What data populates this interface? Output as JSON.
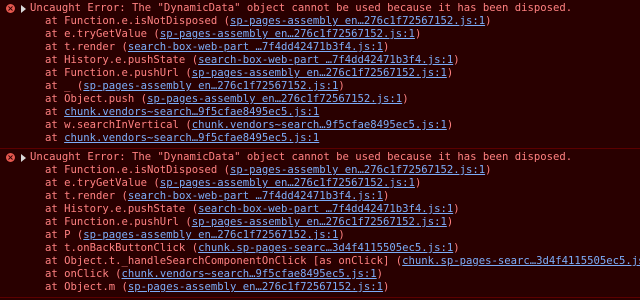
{
  "errors": [
    {
      "message": "Uncaught Error: The \"DynamicData\" object cannot be used because it has been disposed.",
      "frames": [
        {
          "fn": "at Function.e.isNotDisposed (",
          "src": "sp-pages-assembly en…276c1f72567152.js:1",
          "end": ")"
        },
        {
          "fn": "at e.tryGetValue (",
          "src": "sp-pages-assembly en…276c1f72567152.js:1",
          "end": ")"
        },
        {
          "fn": "at t.render (",
          "src": "search-box-web-part …7f4dd42471b3f4.js:1",
          "end": ")"
        },
        {
          "fn": "at History.e.pushState (",
          "src": "search-box-web-part …7f4dd42471b3f4.js:1",
          "end": ")"
        },
        {
          "fn": "at Function.e.pushUrl (",
          "src": "sp-pages-assembly en…276c1f72567152.js:1",
          "end": ")"
        },
        {
          "fn": "at _ (",
          "src": "sp-pages-assembly en…276c1f72567152.js:1",
          "end": ")"
        },
        {
          "fn": "at Object.push (",
          "src": "sp-pages-assembly en…276c1f72567152.js:1",
          "end": ")"
        },
        {
          "fn": "at ",
          "src": "chunk.vendors~search…9f5cfae8495ec5.js:1",
          "end": ""
        },
        {
          "fn": "at w.searchInVertical (",
          "src": "chunk.vendors~search…9f5cfae8495ec5.js:1",
          "end": ")"
        },
        {
          "fn": "at ",
          "src": "chunk.vendors~search…9f5cfae8495ec5.js:1",
          "end": ""
        }
      ]
    },
    {
      "message": "Uncaught Error: The \"DynamicData\" object cannot be used because it has been disposed.",
      "frames": [
        {
          "fn": "at Function.e.isNotDisposed (",
          "src": "sp-pages-assembly en…276c1f72567152.js:1",
          "end": ")"
        },
        {
          "fn": "at e.tryGetValue (",
          "src": "sp-pages-assembly en…276c1f72567152.js:1",
          "end": ")"
        },
        {
          "fn": "at t.render (",
          "src": "search-box-web-part …7f4dd42471b3f4.js:1",
          "end": ")"
        },
        {
          "fn": "at History.e.pushState (",
          "src": "search-box-web-part …7f4dd42471b3f4.js:1",
          "end": ")"
        },
        {
          "fn": "at Function.e.pushUrl (",
          "src": "sp-pages-assembly en…276c1f72567152.js:1",
          "end": ")"
        },
        {
          "fn": "at P (",
          "src": "sp-pages-assembly en…276c1f72567152.js:1",
          "end": ")"
        },
        {
          "fn": "at t.onBackButtonClick (",
          "src": "chunk.sp-pages-searc…3d4f4115505ec5.js:1",
          "end": ")"
        },
        {
          "fn": "at Object.t._handleSearchComponentOnClick [as onClick] (",
          "src": "chunk.sp-pages-searc…3d4f4115505ec5.js:1",
          "end": ")"
        },
        {
          "fn": "at onClick (",
          "src": "chunk.vendors~search…9f5cfae8495ec5.js:1",
          "end": ")"
        },
        {
          "fn": "at Object.m (",
          "src": "sp-pages-assembly en…276c1f72567152.js:1",
          "end": ")"
        }
      ]
    }
  ]
}
